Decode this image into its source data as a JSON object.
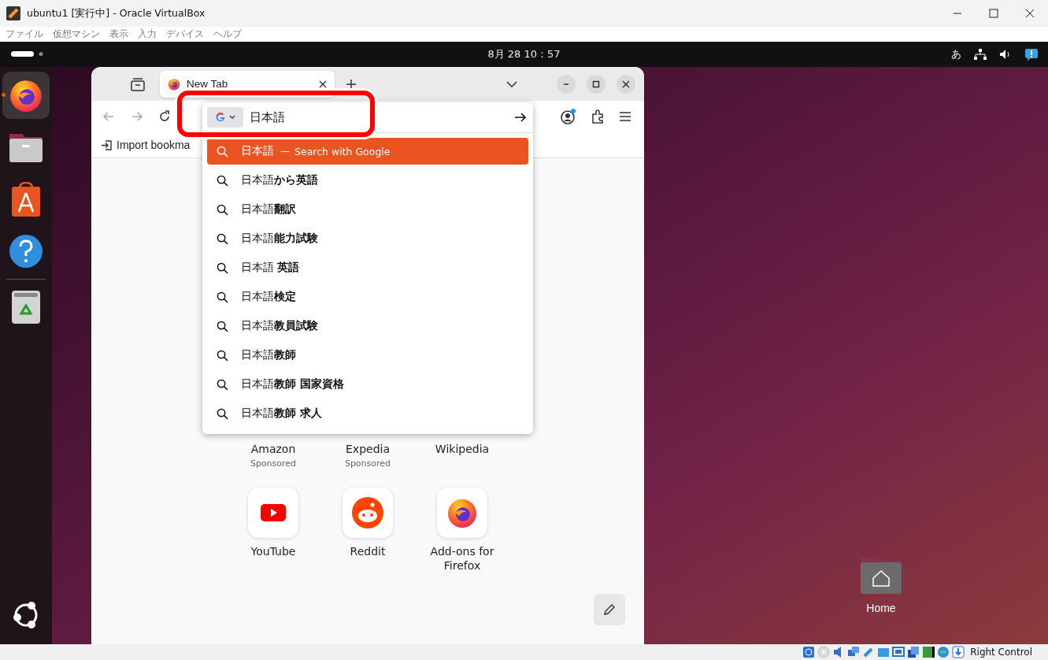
{
  "window": {
    "title": "ubuntu1 [実行中] - Oracle VirtualBox"
  },
  "menu": [
    "ファイル",
    "仮想マシン",
    "表示",
    "入力",
    "デバイス",
    "ヘルプ"
  ],
  "top_bar": {
    "clock": "8月 28 10：57",
    "input_method": "あ"
  },
  "dock": {
    "items": [
      {
        "kind": "firefox",
        "running": true,
        "active": true
      },
      {
        "kind": "files",
        "running": false,
        "active": false
      },
      {
        "kind": "store",
        "running": false,
        "active": false
      },
      {
        "kind": "help",
        "running": false,
        "active": false
      },
      {
        "kind": "trash",
        "running": false,
        "active": false
      }
    ]
  },
  "browser": {
    "tabs": [
      {
        "title": "New Tab",
        "selected": true
      }
    ],
    "bookmarks": [
      "Import bookma"
    ],
    "search": {
      "value": "日本語"
    },
    "suggestions": [
      {
        "text": "日本語",
        "separator": "—",
        "hint": "Search with Google",
        "selected": true
      },
      {
        "text": "日本語**から英語**",
        "selected": false
      },
      {
        "text": "日本語**翻訳**",
        "selected": false
      },
      {
        "text": "日本語**能力試験**",
        "selected": false
      },
      {
        "text": "日本語 **英語**",
        "selected": false
      },
      {
        "text": "日本語**検定**",
        "selected": false
      },
      {
        "text": "日本語**教員試験**",
        "selected": false
      },
      {
        "text": "日本語**教師**",
        "selected": false
      },
      {
        "text": "日本語**教師 国家資格**",
        "selected": false
      },
      {
        "text": "日本語**教師 求人**",
        "selected": false
      }
    ],
    "shortcuts_row_1": [
      {
        "label": "Amazon",
        "sponsor": "Sponsored"
      },
      {
        "label": "Expedia",
        "sponsor": "Sponsored"
      },
      {
        "label": "Wikipedia"
      }
    ],
    "shortcuts_row_2": [
      {
        "label": "YouTube",
        "kind": "youtube"
      },
      {
        "label": "Reddit",
        "kind": "reddit"
      },
      {
        "label": "Add-ons for Firefox",
        "kind": "firefox"
      }
    ]
  },
  "desktop": {
    "icons": [
      {
        "label": "Home"
      }
    ]
  },
  "status_bar": {
    "host_key": "Right Control"
  }
}
